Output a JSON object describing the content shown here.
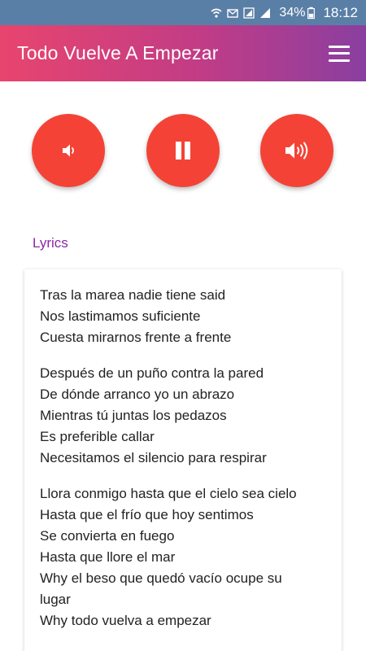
{
  "status_bar": {
    "battery": "34%",
    "time": "18:12"
  },
  "app_bar": {
    "title": "Todo Vuelve A Empezar",
    "menu_icon": "hamburger-menu-icon"
  },
  "controls": [
    {
      "name": "volume-down-button",
      "icon": "volume-low-icon"
    },
    {
      "name": "pause-button",
      "icon": "pause-icon"
    },
    {
      "name": "volume-up-button",
      "icon": "volume-high-icon"
    }
  ],
  "colors": {
    "accent": "#f44336",
    "heading": "#8e24aa",
    "gradient_start": "#e8456e",
    "gradient_end": "#8a3fa0"
  },
  "lyrics": {
    "heading": "Lyrics",
    "stanzas": [
      [
        "Tras la marea nadie tiene said",
        "Nos lastimamos suficiente",
        "Cuesta mirarnos frente a frente"
      ],
      [
        "Después de un puño contra la pared",
        "De dónde arranco yo un abrazo",
        "Mientras tú juntas los pedazos",
        "Es preferible callar",
        "Necesitamos el silencio para respirar"
      ],
      [
        "Llora conmigo hasta que el cielo sea cielo",
        "Hasta que el frío que hoy sentimos",
        "Se convierta en fuego",
        "Hasta que llore el mar",
        "Why el beso que quedó vacío ocupe su",
        "lugar",
        "Why todo vuelva a empezar"
      ]
    ]
  }
}
